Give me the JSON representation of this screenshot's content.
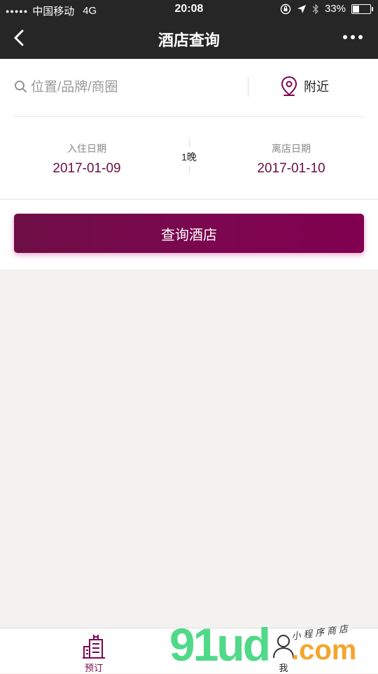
{
  "status_bar": {
    "carrier": "中国移动",
    "network": "4G",
    "time": "20:08",
    "battery": "33%",
    "battery_level": 0.33,
    "icons": [
      "signal-dots-icon",
      "orientation-lock-icon",
      "location-arrow-icon",
      "bluetooth-icon",
      "battery-icon"
    ]
  },
  "nav": {
    "title": "酒店查询",
    "back_icon": "chevron-left-icon",
    "more_icon": "more-dots-icon"
  },
  "search": {
    "placeholder": "位置/品牌/商圈",
    "value": "",
    "nearby_label": "附近",
    "icons": [
      "search-icon",
      "location-pin-icon"
    ]
  },
  "dates": {
    "checkin_label": "入住日期",
    "checkin_date": "2017-01-09",
    "nights": "1晚",
    "checkout_label": "离店日期",
    "checkout_date": "2017-01-10"
  },
  "query_button_label": "查询酒店",
  "tabbar": {
    "items": [
      {
        "label": "预订",
        "icon": "hotel-building-icon",
        "active": true
      },
      {
        "label": "我",
        "icon": "person-icon",
        "active": false
      }
    ]
  },
  "watermark": {
    "brand": "91ud",
    "domain": ".com",
    "tagline": "小程序商店"
  },
  "colors": {
    "accent": "#7d0650",
    "topbar": "#262626",
    "background": "#f3f2f1",
    "watermark_green": "#41d67e",
    "watermark_orange": "#f5a023"
  }
}
